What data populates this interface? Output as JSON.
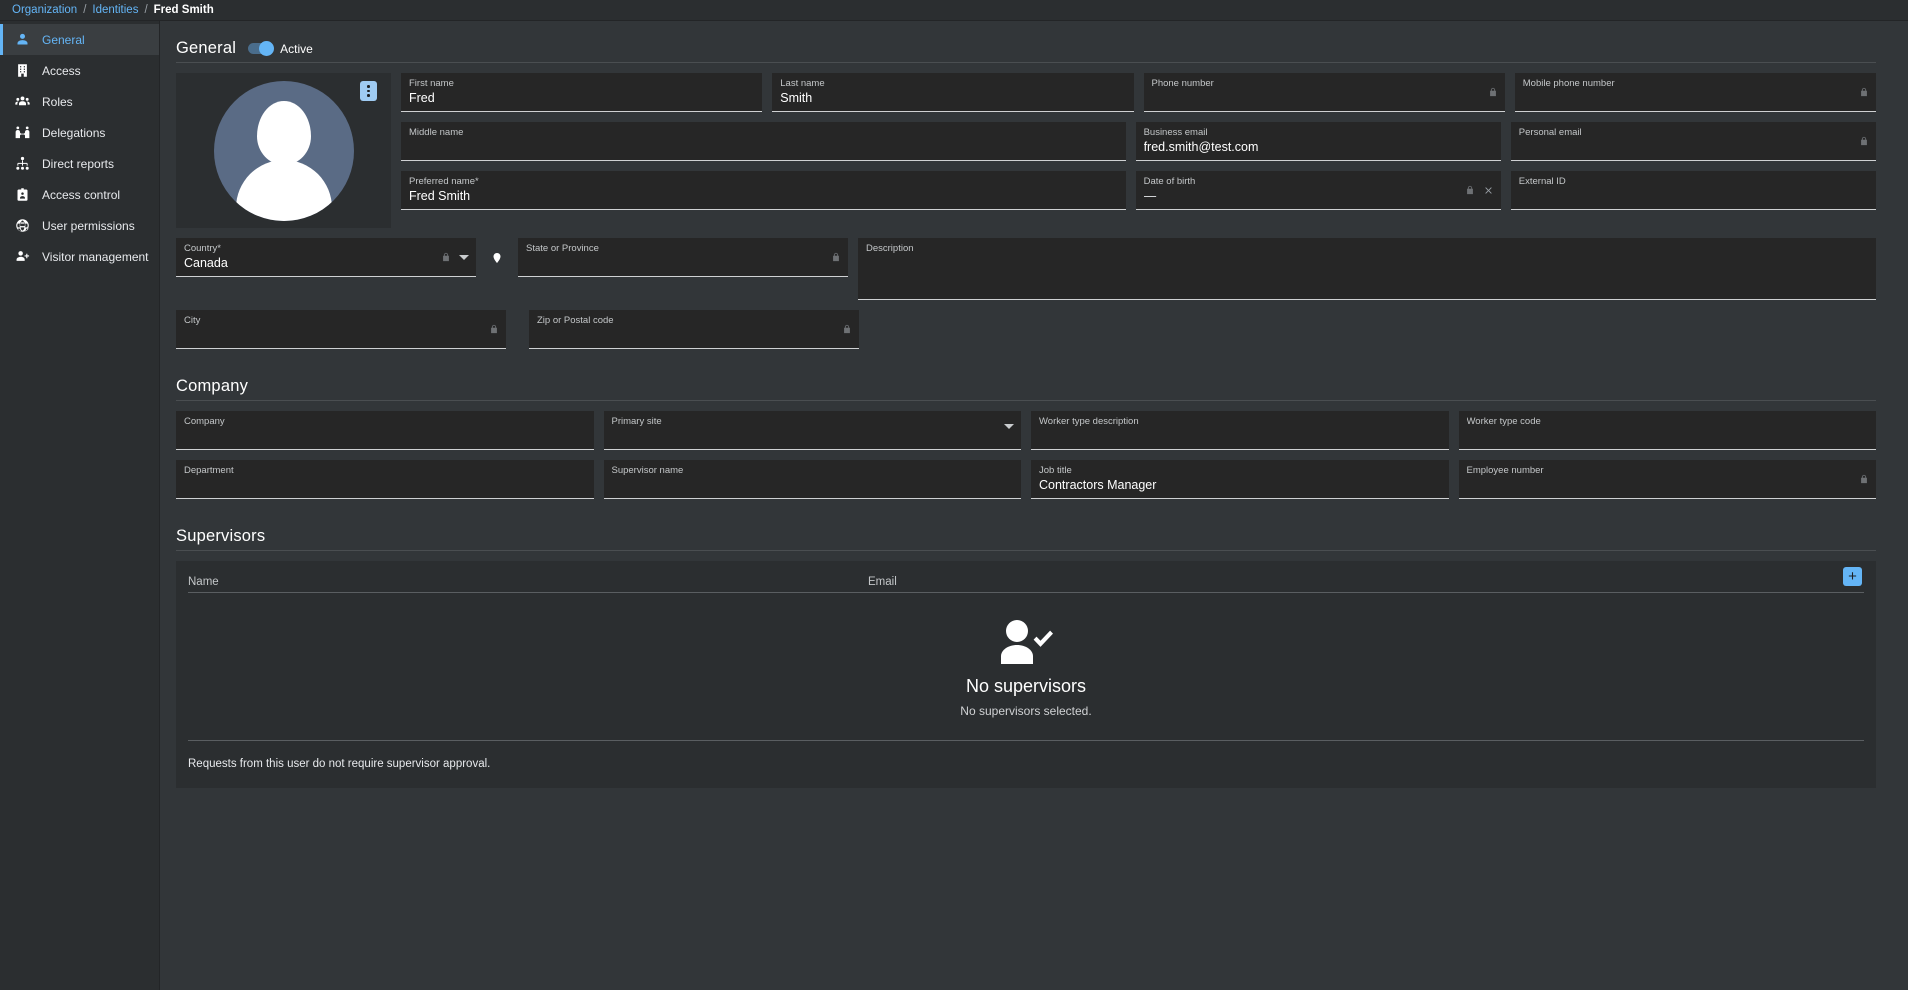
{
  "breadcrumb": {
    "items": [
      {
        "label": "Organization",
        "type": "link"
      },
      {
        "label": "Identities",
        "type": "link"
      },
      {
        "label": "Fred Smith",
        "type": "current"
      }
    ],
    "separator": "/"
  },
  "sidebar": {
    "items": [
      {
        "label": "General",
        "icon": "person-icon",
        "active": true
      },
      {
        "label": "Access",
        "icon": "building-icon",
        "active": false
      },
      {
        "label": "Roles",
        "icon": "people-group-icon",
        "active": false
      },
      {
        "label": "Delegations",
        "icon": "delegation-icon",
        "active": false
      },
      {
        "label": "Direct reports",
        "icon": "org-chart-icon",
        "active": false
      },
      {
        "label": "Access control",
        "icon": "badge-icon",
        "active": false
      },
      {
        "label": "User permissions",
        "icon": "globe-icon",
        "active": false
      },
      {
        "label": "Visitor management",
        "icon": "person-add-icon",
        "active": false
      }
    ]
  },
  "general": {
    "title": "General",
    "status_toggle": {
      "label": "Active",
      "on": true
    },
    "avatar_menu_icon": "kebab-menu-icon",
    "fields": {
      "first_name": {
        "label": "First name",
        "value": "Fred",
        "locked": false
      },
      "last_name": {
        "label": "Last name",
        "value": "Smith",
        "locked": false
      },
      "phone_number": {
        "label": "Phone number",
        "value": "",
        "locked": true
      },
      "mobile_phone": {
        "label": "Mobile phone number",
        "value": "",
        "locked": true
      },
      "middle_name": {
        "label": "Middle name",
        "value": "",
        "locked": false
      },
      "business_email": {
        "label": "Business email",
        "value": "fred.smith@test.com",
        "locked": false
      },
      "personal_email": {
        "label": "Personal email",
        "value": "",
        "locked": true
      },
      "preferred_name": {
        "label": "Preferred name",
        "required": "*",
        "value": "Fred Smith",
        "locked": false
      },
      "date_of_birth": {
        "label": "Date of birth",
        "value": "—",
        "locked": true,
        "clearable": true
      },
      "external_id": {
        "label": "External ID",
        "value": "",
        "locked": false
      },
      "country": {
        "label": "Country",
        "required": "*",
        "value": "Canada",
        "locked": true,
        "dropdown": true
      },
      "state": {
        "label": "State or Province",
        "value": "",
        "locked": true
      },
      "description": {
        "label": "Description",
        "value": "",
        "locked": false
      },
      "city": {
        "label": "City",
        "value": "",
        "locked": true
      },
      "zip": {
        "label": "Zip or Postal code",
        "value": "",
        "locked": true
      }
    },
    "map_pin_icon": "map-pin-icon"
  },
  "company": {
    "title": "Company",
    "fields": {
      "company": {
        "label": "Company",
        "value": "",
        "locked": false
      },
      "primary_site": {
        "label": "Primary site",
        "value": "",
        "dropdown": true,
        "locked": false
      },
      "worker_type_desc": {
        "label": "Worker type description",
        "value": "",
        "locked": false
      },
      "worker_type_code": {
        "label": "Worker type code",
        "value": "",
        "locked": false
      },
      "department": {
        "label": "Department",
        "value": "",
        "locked": false
      },
      "supervisor_name": {
        "label": "Supervisor name",
        "value": "",
        "locked": false
      },
      "job_title": {
        "label": "Job title",
        "value": "Contractors Manager",
        "locked": false
      },
      "employee_number": {
        "label": "Employee number",
        "value": "",
        "locked": true
      }
    }
  },
  "supervisors": {
    "title": "Supervisors",
    "columns": {
      "name": "Name",
      "email": "Email"
    },
    "rows": [],
    "add_button_label": "+",
    "add_button_icon": "plus-icon",
    "empty_state": {
      "icon": "person-check-icon",
      "title": "No supervisors",
      "subtitle": "No supervisors selected."
    },
    "footer_note": "Requests from this user do not require supervisor approval."
  },
  "colors": {
    "page_background": "#323639",
    "panel_background": "#2b2e30",
    "field_background": "#262626",
    "accent_blue": "#64b5f6",
    "avatar_circle": "#5a6b85",
    "text_primary": "#ffffff",
    "text_secondary": "#c4c7c9"
  }
}
